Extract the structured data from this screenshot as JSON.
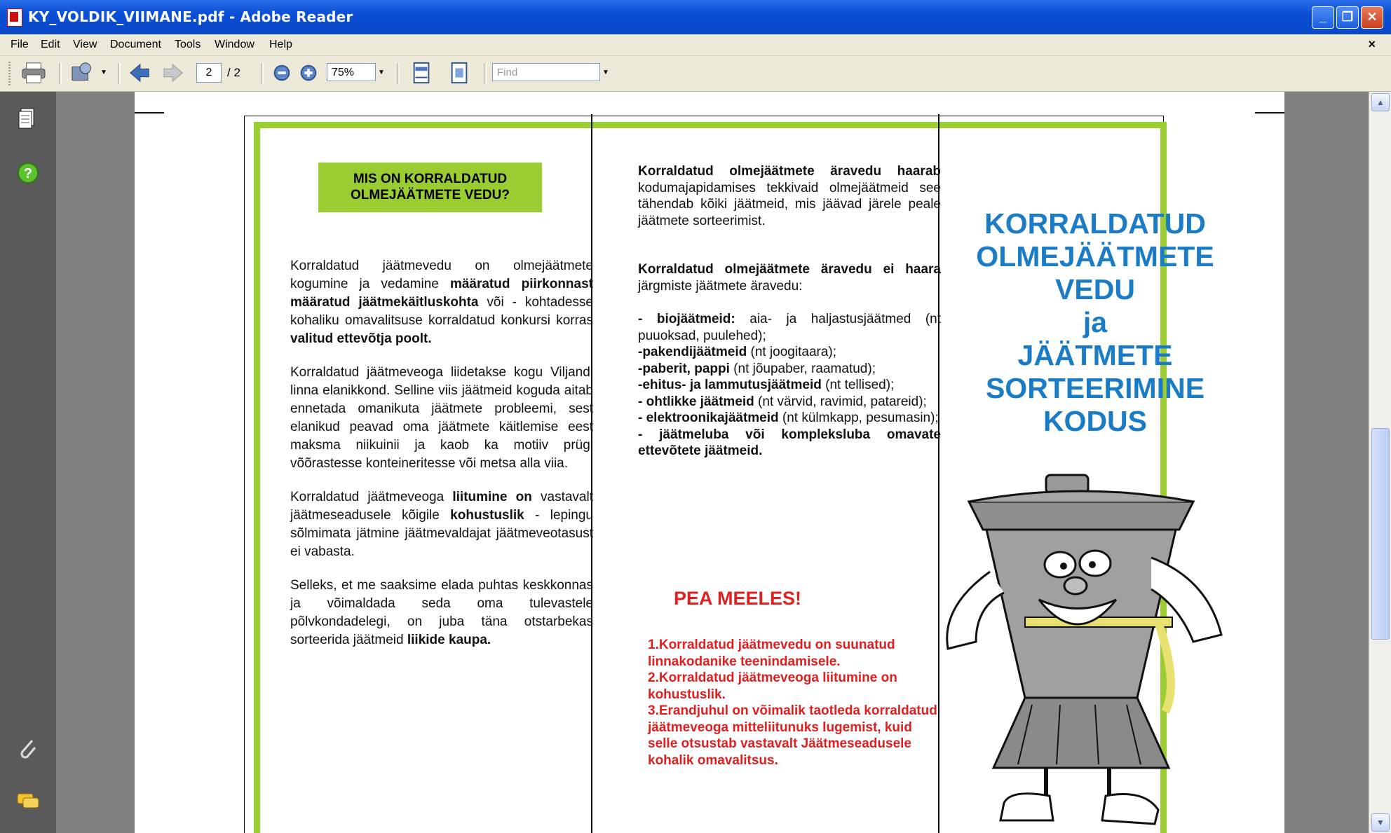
{
  "window": {
    "title": "KY_VOLDIK_VIIMANE.pdf - Adobe Reader"
  },
  "menu": {
    "items": [
      "File",
      "Edit",
      "View",
      "Document",
      "Tools",
      "Window",
      "Help"
    ],
    "close_glyph": "×"
  },
  "toolbar": {
    "current_page": "2",
    "total_pages": "/ 2",
    "zoom": "75%",
    "find_placeholder": "Find"
  },
  "icons": [
    "pdf-icon",
    "minimize-icon",
    "restore-icon",
    "close-icon",
    "print-icon",
    "share-icon",
    "prev-page-icon",
    "next-page-icon",
    "zoom-out-icon",
    "zoom-in-icon",
    "fit-width-icon",
    "fit-page-icon",
    "pages-icon",
    "help-icon",
    "attachment-icon",
    "comments-icon"
  ],
  "document": {
    "col1": {
      "heading_line1": "MIS ON KORRALDATUD",
      "heading_line2": "OLMEJÄÄTMETE VEDU?",
      "p1_a": "Korraldatud jäätmevedu on olmejäätmete kogumine ja vedamine ",
      "p1_b": "määratud piirkonnast määratud jäätmekäitluskohta",
      "p1_c": " või - kohtadesse kohaliku omavalitsuse korraldatud konkursi korras ",
      "p1_d": "valitud ettevõtja poolt.",
      "p2": "Korraldatud jäätmeveoga liidetakse kogu Viljandi linna elanikkond. Selline viis jäätmeid koguda aitab ennetada omanikuta jäätmete probleemi, sest elanikud peavad oma jäätmete käitlemise eest maksma niikuinii ja kaob ka motiiv prügi võõrastesse konteineritesse või metsa alla viia.",
      "p3_a": "Korraldatud jäätmeveoga ",
      "p3_b": "liitumine on",
      "p3_c": " vastavalt jäätmeseadusele kõigile ",
      "p3_d": "kohustuslik",
      "p3_e": " - lepingu sõlmimata jätmine jäätmevaldajat jäätmeveotasust ei vabasta.",
      "p4_a": "Selleks, et me saaksime elada puhtas keskkonnas ja võimaldada seda oma tulevastele põlvkondadelegi, on juba täna otstarbekas sorteerida jäätmeid ",
      "p4_b": "liikide kaupa."
    },
    "col2": {
      "p1_a": "Korraldatud olmejäätmete äravedu haarab",
      "p1_b": " kodumajapidamises tekkivaid olmejäätmeid see tähendab kõiki jäätmeid, mis jäävad järele peale jäätmete sorteerimist.",
      "p2_a": "Korraldatud olmejäätmete äravedu ei haara",
      "p2_b": " järgmiste jäätmete äravedu:",
      "items": [
        {
          "b": "- biojäätmeid:",
          "t": " aia- ja haljastusjäätmed (nt puuoksad, puulehed);"
        },
        {
          "b": "-pakendijäätmeid",
          "t": " (nt joogitaara);"
        },
        {
          "b": "-paberit, pappi",
          "t": " (nt jõupaber, raamatud);"
        },
        {
          "b": "-ehitus- ja lammutusjäätmeid",
          "t": " (nt tellised);"
        },
        {
          "b": "- ohtlikke jäätmeid",
          "t": " (nt värvid, ravimid, patareid);"
        },
        {
          "b": "- elektroonikajäätmeid",
          "t": " (nt külmkapp, pesumasin);"
        },
        {
          "b": "- jäätmeluba või kompleksluba omavate ettevõtete jäätmeid.",
          "t": ""
        }
      ],
      "pea_meeles": "PEA MEELES!",
      "r1": "1.Korraldatud jäätmevedu on suunatud linnakodanike teenindamisele.",
      "r2": "2.Korraldatud jäätmeveoga liitumine on kohustuslik.",
      "r3": "3.Erandjuhul on võimalik taotleda korraldatud jäätmeveoga mitteliitunuks lugemist, kuid selle otsustab vastavalt Jäätmeseadusele kohalik omavalitsus."
    },
    "col3": {
      "t1": "KORRALDATUD",
      "t2": "OLMEJÄÄTMETE",
      "t3": "VEDU",
      "t4": "ja",
      "t5": "JÄÄTMETE",
      "t6": "SORTEERIMINE",
      "t7": "KODUS"
    }
  },
  "colors": {
    "accent_green": "#9acd32",
    "title_blue": "#1a7cc7",
    "warning_red": "#e02020"
  }
}
